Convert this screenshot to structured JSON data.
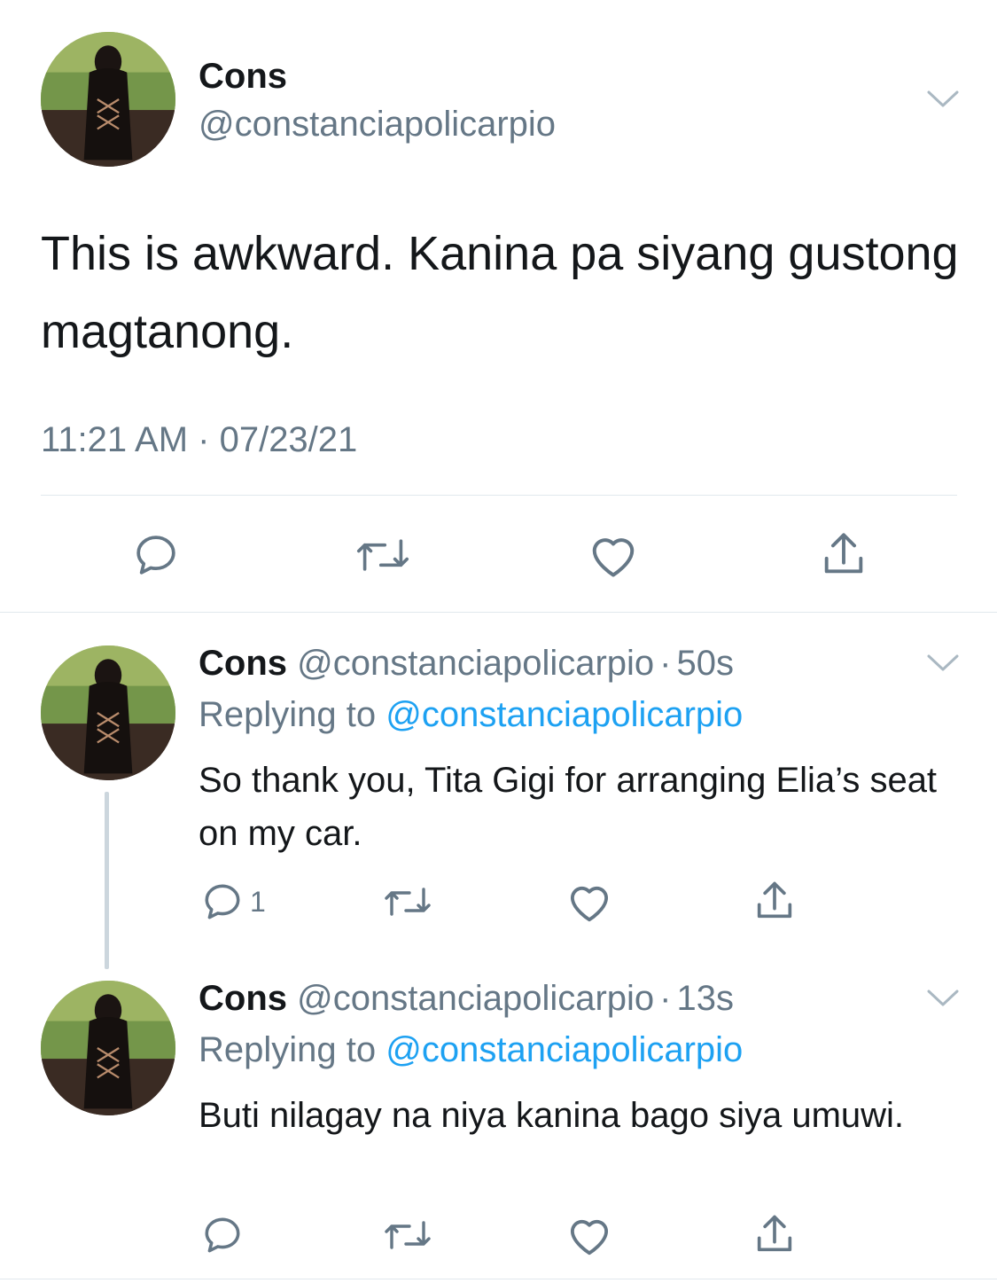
{
  "main_tweet": {
    "name": "Cons",
    "handle": "@constanciapolicarpio",
    "text": "This is awkward. Kanina pa siyang gustong magtanong.",
    "timestamp": "11:21 AM · 07/23/21",
    "actions": [
      "reply-icon",
      "retweet-icon",
      "like-icon",
      "share-icon"
    ]
  },
  "replies": [
    {
      "name": "Cons",
      "handle": "@constanciapolicarpio",
      "dot": "·",
      "time": "50s",
      "replying_label": "Replying to",
      "replying_to": "@constanciapolicarpio",
      "text": "So thank you, Tita Gigi for arranging Elia’s seat on my car.",
      "reply_count": "1"
    },
    {
      "name": "Cons",
      "handle": "@constanciapolicarpio",
      "dot": "·",
      "time": "13s",
      "replying_label": "Replying to",
      "replying_to": "@constanciapolicarpio",
      "text": "Buti nilagay na niya kanina bago siya umuwi.",
      "reply_count": ""
    }
  ],
  "colors": {
    "text": "#14171a",
    "secondary": "#657786",
    "link": "#1da1f2",
    "divider": "#e1e8ed",
    "thread_line": "#ccd6dd"
  }
}
